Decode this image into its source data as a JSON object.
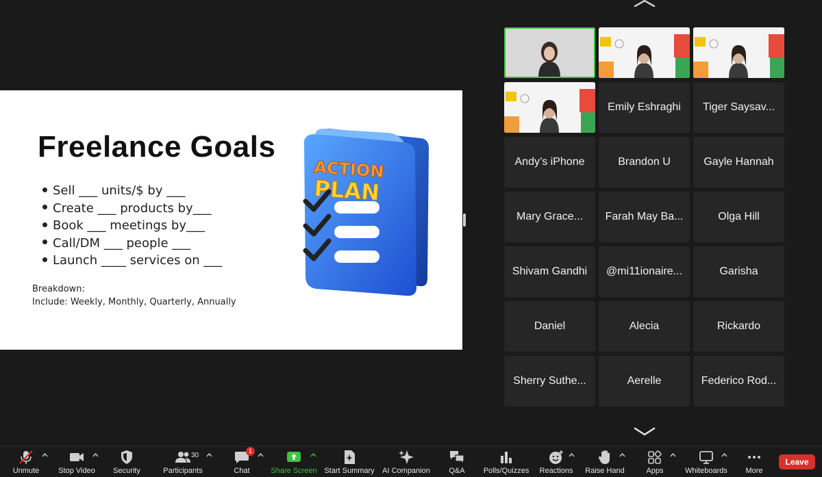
{
  "slide": {
    "title": "Freelance Goals",
    "bullets": [
      "Sell ___ units/$  by ___",
      "Create ___ products by___",
      "Book ___  meetings by___",
      "Call/DM ___ people ___",
      "Launch ____ services on ___"
    ],
    "breakdown_label": "Breakdown:",
    "breakdown_text": "Include: Weekly, Monthly, Quarterly, Annually",
    "graphic_line1": "ACTION",
    "graphic_line2": "PLAN"
  },
  "gallery": {
    "participants": [
      {
        "name": "",
        "kind": "video-speaker",
        "active": true
      },
      {
        "name": "",
        "kind": "video-slide"
      },
      {
        "name": "",
        "kind": "video-slide"
      },
      {
        "name": "",
        "kind": "video-slide"
      },
      {
        "name": "Emily Eshraghi"
      },
      {
        "name": "Tiger Saysav..."
      },
      {
        "name": "Andy’s iPhone"
      },
      {
        "name": "Brandon U"
      },
      {
        "name": "Gayle Hannah"
      },
      {
        "name": "Mary Grace..."
      },
      {
        "name": "Farah May Ba..."
      },
      {
        "name": "Olga Hill"
      },
      {
        "name": "Shivam Gandhi"
      },
      {
        "name": "@mi11ionaire..."
      },
      {
        "name": "Garisha"
      },
      {
        "name": "Daniel"
      },
      {
        "name": "Alecia"
      },
      {
        "name": "Rickardo"
      },
      {
        "name": "Sherry Suthe..."
      },
      {
        "name": "Aerelle"
      },
      {
        "name": "Federico Rod..."
      }
    ]
  },
  "toolbar": {
    "unmute": "Unmute",
    "stop_video": "Stop Video",
    "security": "Security",
    "participants": "Participants",
    "participants_count": "30",
    "chat": "Chat",
    "chat_badge": "1",
    "share_screen": "Share Screen",
    "start_summary": "Start Summary",
    "ai_companion": "AI Companion",
    "qa": "Q&A",
    "polls": "Polls/Quizzes",
    "reactions": "Reactions",
    "raise_hand": "Raise Hand",
    "apps": "Apps",
    "whiteboards": "Whiteboards",
    "more": "More",
    "leave": "Leave"
  },
  "colors": {
    "background": "#1a1a1a",
    "tile": "#262626",
    "active_border": "#3ec43e",
    "share_green": "#3ec43e",
    "leave_red": "#d9302c",
    "badge_red": "#e02828"
  }
}
